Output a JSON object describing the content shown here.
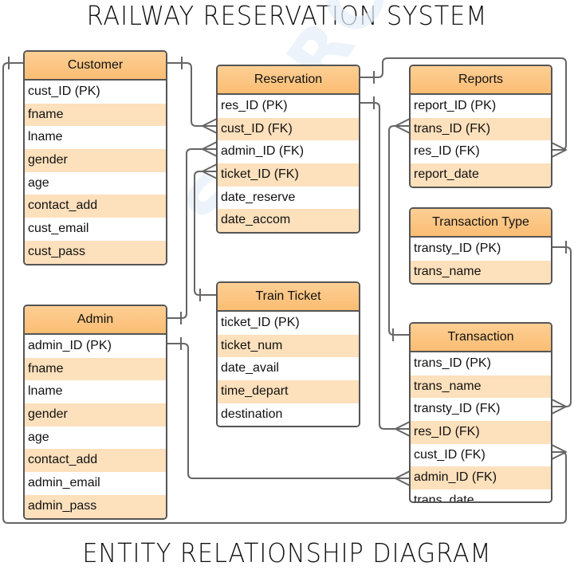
{
  "titles": {
    "top": "RAILWAY RESERVATION SYSTEM",
    "bottom": "ENTITY RELATIONSHIP DIAGRAM"
  },
  "watermark": "SOURCE",
  "colors": {
    "header_fill": "#fbbd73",
    "stripe_fill": "#fde0bc",
    "border": "#555555",
    "line": "#666666"
  },
  "entities": {
    "customer": {
      "name": "Customer",
      "attributes": [
        "cust_ID (PK)",
        "fname",
        "lname",
        "gender",
        "age",
        "contact_add",
        "cust_email",
        "cust_pass"
      ]
    },
    "reservation": {
      "name": "Reservation",
      "attributes": [
        "res_ID (PK)",
        "cust_ID (FK)",
        "admin_ID (FK)",
        "ticket_ID (FK)",
        "date_reserve",
        "date_accom"
      ]
    },
    "reports": {
      "name": "Reports",
      "attributes": [
        "report_ID (PK)",
        "trans_ID (FK)",
        "res_ID (FK)",
        "report_date"
      ]
    },
    "transaction_type": {
      "name": "Transaction Type",
      "attributes": [
        "transty_ID (PK)",
        "trans_name"
      ]
    },
    "admin": {
      "name": "Admin",
      "attributes": [
        "admin_ID (PK)",
        "fname",
        "lname",
        "gender",
        "age",
        "contact_add",
        "admin_email",
        "admin_pass"
      ]
    },
    "train_ticket": {
      "name": "Train Ticket",
      "attributes": [
        "ticket_ID (PK)",
        "ticket_num",
        "date_avail",
        "time_depart",
        "destination"
      ]
    },
    "transaction": {
      "name": "Transaction",
      "attributes": [
        "trans_ID (PK)",
        "trans_name",
        "transty_ID (FK)",
        "res_ID (FK)",
        "cust_ID (FK)",
        "admin_ID (FK)",
        "trans_date"
      ]
    }
  },
  "relationships": [
    {
      "from": "Customer",
      "to": "Reservation.cust_ID (FK)",
      "cardinality": "one-to-many"
    },
    {
      "from": "Admin",
      "to": "Reservation.admin_ID (FK)",
      "cardinality": "one-to-many"
    },
    {
      "from": "Train Ticket",
      "to": "Reservation.ticket_ID (FK)",
      "cardinality": "one-to-many"
    },
    {
      "from": "Reservation",
      "to": "Reports.res_ID (FK)",
      "cardinality": "one-to-many"
    },
    {
      "from": "Reservation",
      "to": "Transaction.res_ID (FK)",
      "cardinality": "one-to-many"
    },
    {
      "from": "Transaction",
      "to": "Reports.trans_ID (FK)",
      "cardinality": "one-to-many"
    },
    {
      "from": "Transaction Type",
      "to": "Transaction.transty_ID (FK)",
      "cardinality": "one-to-many"
    },
    {
      "from": "Customer",
      "to": "Transaction.cust_ID (FK)",
      "cardinality": "one-to-many"
    },
    {
      "from": "Admin",
      "to": "Transaction.admin_ID (FK)",
      "cardinality": "one-to-many"
    }
  ]
}
